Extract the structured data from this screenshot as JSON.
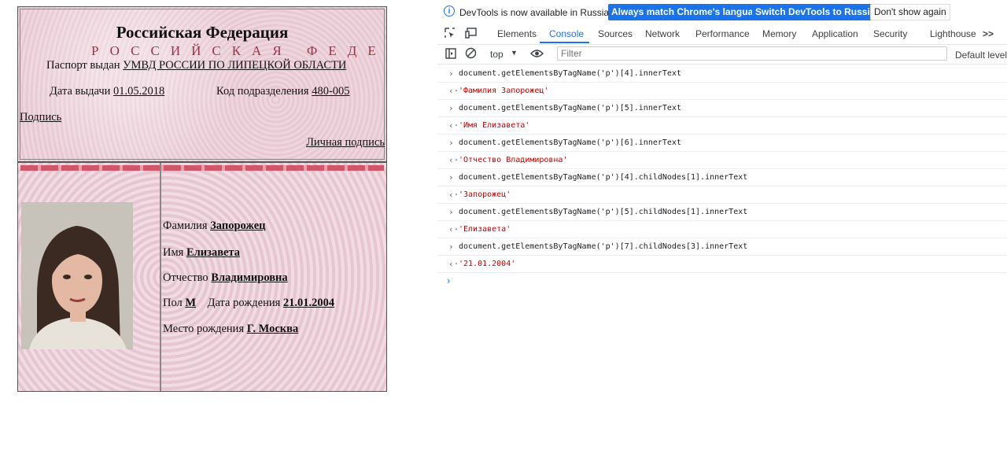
{
  "passport": {
    "title": "Российская Федерация",
    "watermark": "РОССИЙСКАЯ ФЕДЕ",
    "issued_label": "Паспорт выдан",
    "issued_value": "УМВД РОССИИ ПО ЛИПЕЦКОЙ ОБЛАСТИ",
    "issue_date_label": "Дата выдачи",
    "issue_date_value": "01.05.2018",
    "division_code_label": "Код подразделения",
    "division_code_value": "480-005",
    "signature_label": "Подпись",
    "personal_signature_label": "Личная подпись",
    "surname_label": "Фамилия",
    "surname_value": "Запорожец",
    "name_label": "Имя",
    "name_value": "Елизавета",
    "patronymic_label": "Отчество",
    "patronymic_value": "Владимировна",
    "sex_label": "Пол",
    "sex_value": "М",
    "birth_date_label": "Дата рождения",
    "birth_date_value": "21.01.2004",
    "birth_place_label": "Место рождения",
    "birth_place_value": "Г. Москва"
  },
  "devtools": {
    "banner": {
      "message": "DevTools is now available in Russian!",
      "btn_match": "Always match Chrome's language",
      "btn_switch": "Switch DevTools to Russian",
      "btn_dismiss": "Don't show again"
    },
    "tabs": [
      "Elements",
      "Console",
      "Sources",
      "Network",
      "Performance",
      "Memory",
      "Application",
      "Security",
      "Lighthouse"
    ],
    "active_tab": "Console",
    "more_tabs": ">>",
    "toolbar": {
      "context": "top",
      "filter_placeholder": "Filter",
      "levels": "Default levels"
    },
    "console": [
      {
        "type": "input",
        "text": "document.getElementsByTagName('p')[4].innerText"
      },
      {
        "type": "output",
        "text": "'Фамилия Запорожец'"
      },
      {
        "type": "input",
        "text": "document.getElementsByTagName('p')[5].innerText"
      },
      {
        "type": "output",
        "text": "'Имя Елизавета'"
      },
      {
        "type": "input",
        "text": "document.getElementsByTagName('p')[6].innerText"
      },
      {
        "type": "output",
        "text": "'Отчество Владимировна'"
      },
      {
        "type": "input",
        "text": "document.getElementsByTagName('p')[4].childNodes[1].innerText"
      },
      {
        "type": "output",
        "text": "'Запорожец'"
      },
      {
        "type": "input",
        "text": "document.getElementsByTagName('p')[5].childNodes[1].innerText"
      },
      {
        "type": "output",
        "text": "'Елизавета'"
      },
      {
        "type": "input",
        "text": "document.getElementsByTagName('p')[7].childNodes[3].innerText"
      },
      {
        "type": "output",
        "text": "'21.01.2004'"
      }
    ],
    "colors": {
      "accent": "#1a73e8",
      "output_string": "#c80000"
    }
  }
}
